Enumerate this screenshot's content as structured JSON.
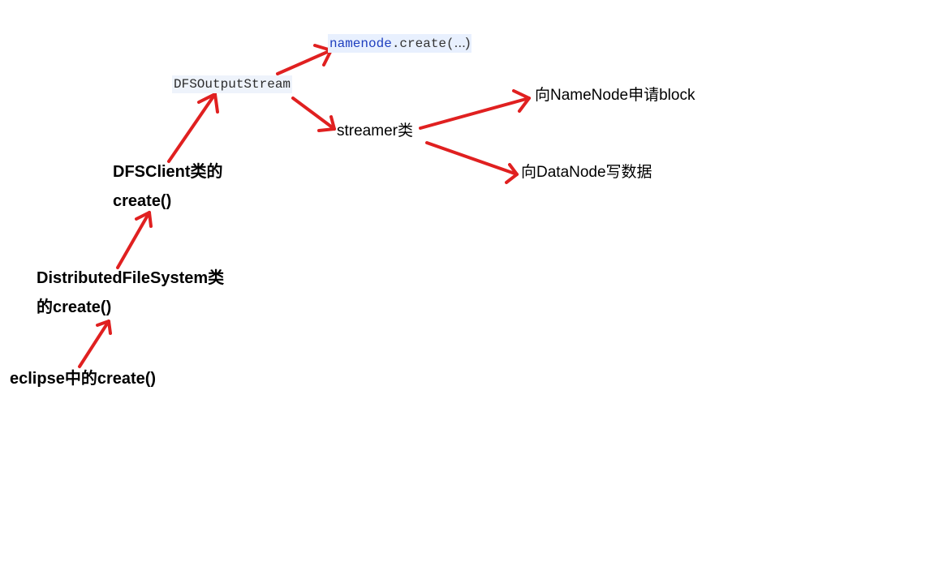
{
  "arrow_color": "#e02020",
  "nodes": {
    "eclipse": "eclipse中的create()",
    "dfs_line1": "DistributedFileSystem类",
    "dfs_line2": "的create()",
    "client_line1": "DFSClient类的",
    "client_line2": "create()",
    "output_stream": "DFSOutputStream",
    "namenode_obj": "namenode",
    "namenode_call": ".create(",
    "namenode_ellipsis": "...)",
    "streamer": "streamer类",
    "namenode_request": "向NameNode申请block",
    "datanode_write": "向DataNode写数据"
  }
}
